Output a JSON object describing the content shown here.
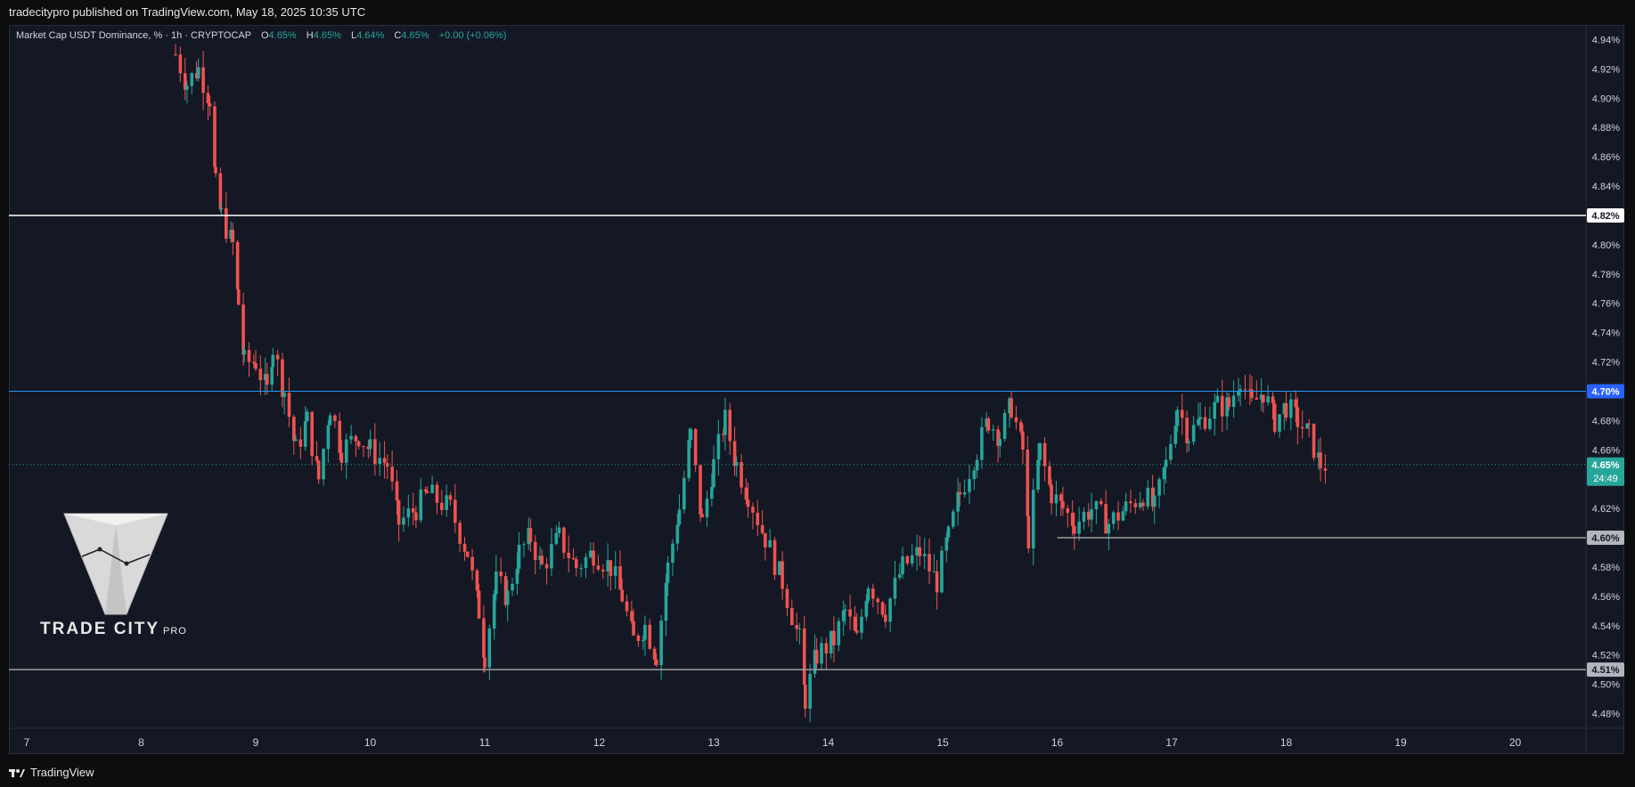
{
  "header": {
    "published": "tradecitypro published on TradingView.com, May 18, 2025 10:35 UTC"
  },
  "legend": {
    "symbol": "Market Cap USDT Dominance, % · 1h · CRYPTOCAP",
    "o_label": "O",
    "o_value": "4.65%",
    "h_label": "H",
    "h_value": "4.65%",
    "l_label": "L",
    "l_value": "4.64%",
    "c_label": "C",
    "c_value": "4.65%",
    "change": "+0.00 (+0.06%)"
  },
  "footer": {
    "brand": "TradingView"
  },
  "logo": {
    "name": "TRADE CITY",
    "suffix": "PRO"
  },
  "colors": {
    "up": "#26a69a",
    "down": "#ef5350",
    "background": "#141824",
    "blue_line": "#2196f3",
    "white_line": "#ffffff",
    "gray_line": "#9e9e9e"
  },
  "chart_data": {
    "type": "candlestick",
    "title": "Market Cap USDT Dominance, %",
    "interval": "1h",
    "ylim": [
      4.47,
      4.95
    ],
    "y_ticks": [
      "4.94%",
      "4.92%",
      "4.90%",
      "4.88%",
      "4.86%",
      "4.84%",
      "4.82%",
      "4.80%",
      "4.78%",
      "4.76%",
      "4.74%",
      "4.72%",
      "4.70%",
      "4.68%",
      "4.66%",
      "4.64%",
      "4.62%",
      "4.60%",
      "4.58%",
      "4.56%",
      "4.54%",
      "4.52%",
      "4.50%",
      "4.48%"
    ],
    "x_ticks": [
      "7",
      "8",
      "9",
      "10",
      "11",
      "12",
      "13",
      "14",
      "15",
      "16",
      "17",
      "18",
      "19",
      "20"
    ],
    "horizontal_lines": [
      {
        "value": 4.82,
        "label": "4.82%",
        "style": "white"
      },
      {
        "value": 4.7,
        "label": "4.70%",
        "style": "blue"
      },
      {
        "value": 4.6,
        "label": "4.60%",
        "style": "gray",
        "start_day": 16.0
      },
      {
        "value": 4.51,
        "label": "4.51%",
        "style": "gray"
      }
    ],
    "last_price": {
      "value": 4.65,
      "label": "4.65%",
      "countdown": "24:49"
    },
    "close_path": [
      [
        8.3,
        4.93
      ],
      [
        8.4,
        4.91
      ],
      [
        8.5,
        4.92
      ],
      [
        8.6,
        4.9
      ],
      [
        8.65,
        4.84
      ],
      [
        8.7,
        4.82
      ],
      [
        8.8,
        4.8
      ],
      [
        8.85,
        4.76
      ],
      [
        8.9,
        4.72
      ],
      [
        9.0,
        4.72
      ],
      [
        9.1,
        4.7
      ],
      [
        9.15,
        4.73
      ],
      [
        9.25,
        4.7
      ],
      [
        9.35,
        4.66
      ],
      [
        9.45,
        4.68
      ],
      [
        9.55,
        4.64
      ],
      [
        9.65,
        4.69
      ],
      [
        9.75,
        4.66
      ],
      [
        9.9,
        4.67
      ],
      [
        10.0,
        4.66
      ],
      [
        10.15,
        4.65
      ],
      [
        10.25,
        4.61
      ],
      [
        10.4,
        4.62
      ],
      [
        10.5,
        4.63
      ],
      [
        10.7,
        4.62
      ],
      [
        10.85,
        4.59
      ],
      [
        10.95,
        4.55
      ],
      [
        11.0,
        4.52
      ],
      [
        11.1,
        4.57
      ],
      [
        11.2,
        4.56
      ],
      [
        11.3,
        4.59
      ],
      [
        11.4,
        4.6
      ],
      [
        11.5,
        4.58
      ],
      [
        11.65,
        4.6
      ],
      [
        11.8,
        4.58
      ],
      [
        11.95,
        4.59
      ],
      [
        12.1,
        4.58
      ],
      [
        12.2,
        4.56
      ],
      [
        12.3,
        4.53
      ],
      [
        12.4,
        4.54
      ],
      [
        12.5,
        4.52
      ],
      [
        12.6,
        4.58
      ],
      [
        12.7,
        4.62
      ],
      [
        12.8,
        4.67
      ],
      [
        12.9,
        4.61
      ],
      [
        13.0,
        4.65
      ],
      [
        13.1,
        4.68
      ],
      [
        13.2,
        4.65
      ],
      [
        13.3,
        4.63
      ],
      [
        13.45,
        4.6
      ],
      [
        13.6,
        4.57
      ],
      [
        13.75,
        4.53
      ],
      [
        13.8,
        4.49
      ],
      [
        13.9,
        4.52
      ],
      [
        14.05,
        4.53
      ],
      [
        14.15,
        4.55
      ],
      [
        14.25,
        4.53
      ],
      [
        14.35,
        4.57
      ],
      [
        14.5,
        4.55
      ],
      [
        14.65,
        4.58
      ],
      [
        14.8,
        4.59
      ],
      [
        14.95,
        4.57
      ],
      [
        15.05,
        4.6
      ],
      [
        15.15,
        4.63
      ],
      [
        15.3,
        4.66
      ],
      [
        15.4,
        4.68
      ],
      [
        15.5,
        4.67
      ],
      [
        15.6,
        4.69
      ],
      [
        15.7,
        4.66
      ],
      [
        15.75,
        4.6
      ],
      [
        15.85,
        4.66
      ],
      [
        15.95,
        4.63
      ],
      [
        16.05,
        4.62
      ],
      [
        16.15,
        4.61
      ],
      [
        16.3,
        4.62
      ],
      [
        16.45,
        4.61
      ],
      [
        16.6,
        4.62
      ],
      [
        16.75,
        4.63
      ],
      [
        16.85,
        4.62
      ],
      [
        16.95,
        4.65
      ],
      [
        17.05,
        4.69
      ],
      [
        17.15,
        4.67
      ],
      [
        17.25,
        4.68
      ],
      [
        17.4,
        4.69
      ],
      [
        17.5,
        4.69
      ],
      [
        17.6,
        4.71
      ],
      [
        17.7,
        4.69
      ],
      [
        17.8,
        4.7
      ],
      [
        17.9,
        4.68
      ],
      [
        18.0,
        4.69
      ],
      [
        18.1,
        4.68
      ],
      [
        18.2,
        4.67
      ],
      [
        18.3,
        4.65
      ],
      [
        18.38,
        4.65
      ]
    ]
  }
}
